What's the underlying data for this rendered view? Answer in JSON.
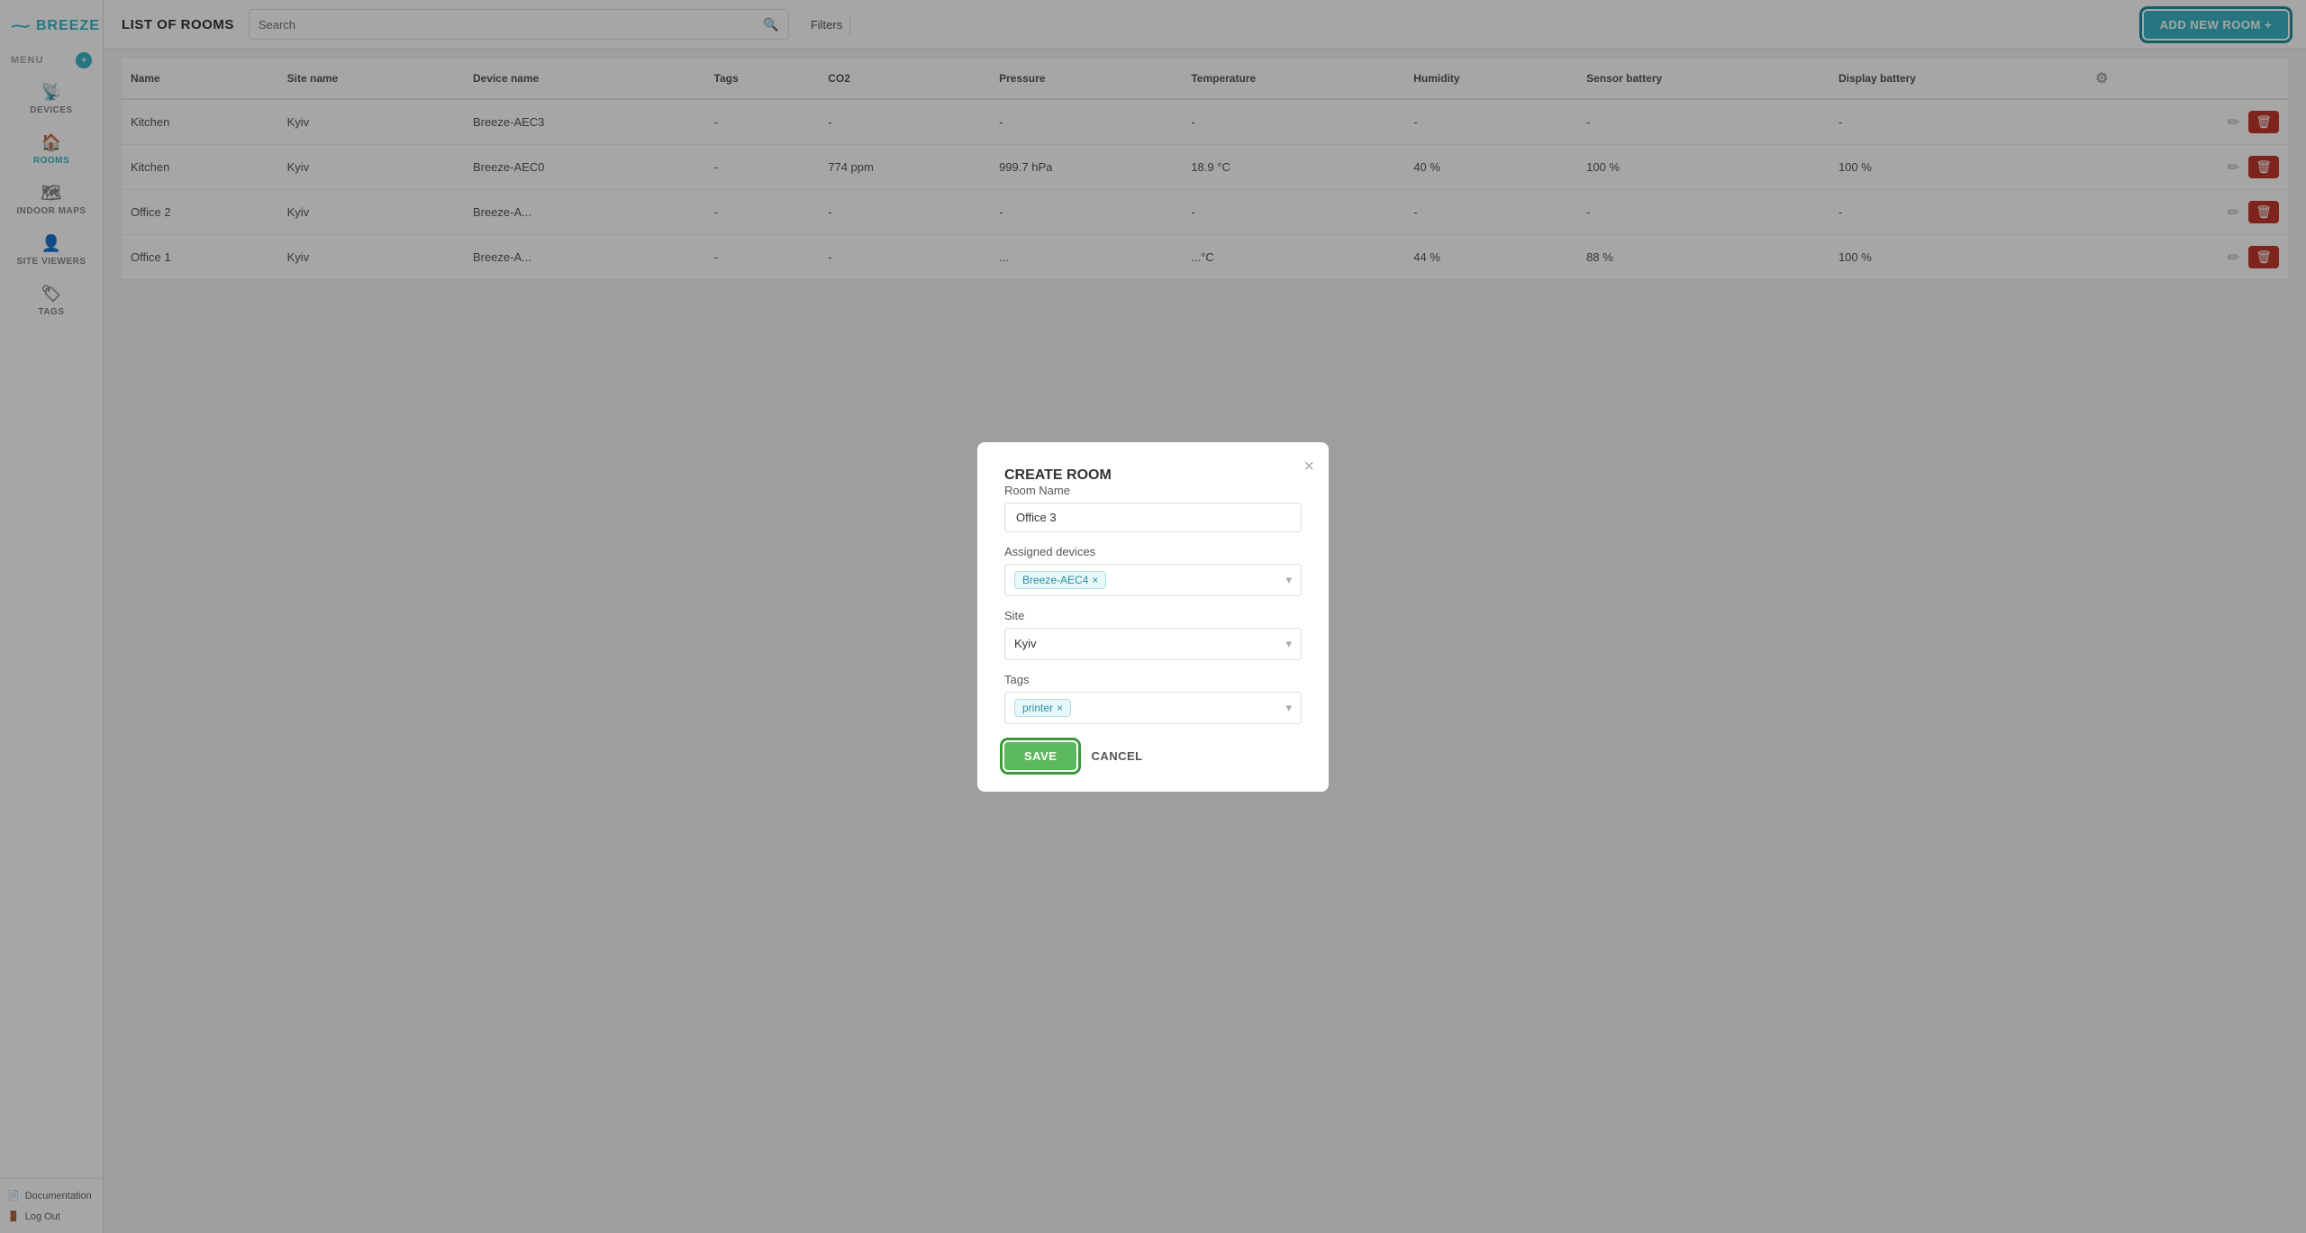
{
  "app": {
    "name": "BREEZE",
    "logo_symbol": "~"
  },
  "sidebar": {
    "menu_label": "MENU",
    "menu_badge": "+",
    "items": [
      {
        "id": "devices",
        "label": "DEVICES",
        "icon": "📡",
        "active": false
      },
      {
        "id": "rooms",
        "label": "ROOMS",
        "icon": "🏠",
        "active": true
      },
      {
        "id": "indoor-maps",
        "label": "INDOOR MAPS",
        "icon": "🗺",
        "active": false
      },
      {
        "id": "site-viewers",
        "label": "SITE VIEWERS",
        "icon": "👤",
        "active": false
      },
      {
        "id": "tags",
        "label": "TAGS",
        "icon": "🏷",
        "active": false
      }
    ],
    "bottom": [
      {
        "id": "documentation",
        "label": "Documentation",
        "icon": "📄"
      },
      {
        "id": "logout",
        "label": "Log Out",
        "icon": "🚪"
      }
    ]
  },
  "topbar": {
    "page_title": "LIST OF ROOMS",
    "search_placeholder": "Search",
    "filters_label": "Filters",
    "add_button_label": "ADD NEW ROOM +"
  },
  "table": {
    "columns": [
      "Name",
      "Site name",
      "Device name",
      "Tags",
      "CO2",
      "Pressure",
      "Temperature",
      "Humidity",
      "Sensor battery",
      "Display battery"
    ],
    "rows": [
      {
        "name": "Kitchen",
        "site": "Kyiv",
        "device": "Breeze-AEC3",
        "tags": "-",
        "co2": "-",
        "pressure": "-",
        "temp": "-",
        "humidity": "-",
        "sensor_battery": "-",
        "display_battery": "-"
      },
      {
        "name": "Kitchen",
        "site": "Kyiv",
        "device": "Breeze-AEC0",
        "tags": "-",
        "co2": "774 ppm",
        "pressure": "999.7 hPa",
        "temp": "18.9 °C",
        "humidity": "40 %",
        "sensor_battery": "100 %",
        "display_battery": "100 %"
      },
      {
        "name": "Office 2",
        "site": "Kyiv",
        "device": "Breeze-A...",
        "tags": "-",
        "co2": "-",
        "pressure": "-",
        "temp": "-",
        "humidity": "-",
        "sensor_battery": "-",
        "display_battery": "-"
      },
      {
        "name": "Office 1",
        "site": "Kyiv",
        "device": "Breeze-A...",
        "tags": "-",
        "co2": "-",
        "pressure": "...",
        "temp": "...°C",
        "humidity": "44 %",
        "sensor_battery": "88 %",
        "display_battery": "100 %"
      }
    ]
  },
  "modal": {
    "title": "CREATE ROOM",
    "close_label": "×",
    "fields": {
      "room_name_label": "Room Name",
      "room_name_value": "Office 3",
      "assigned_devices_label": "Assigned devices",
      "assigned_devices_chip": "Breeze-AEC4",
      "site_label": "Site",
      "site_value": "Kyiv",
      "tags_label": "Tags",
      "tags_chip": "printer"
    },
    "save_label": "SAVE",
    "cancel_label": "CANCEL"
  }
}
